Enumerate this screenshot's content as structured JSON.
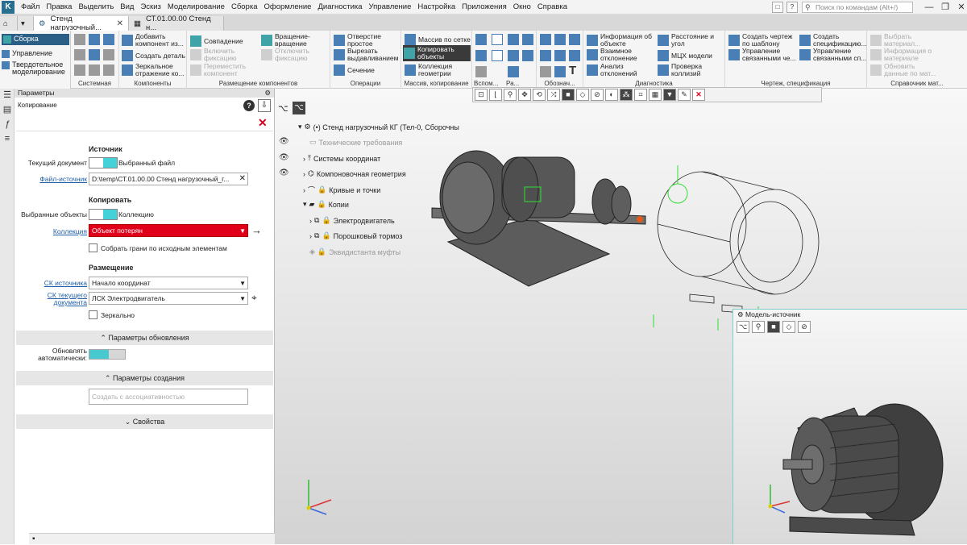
{
  "menubar": {
    "items": [
      "Файл",
      "Правка",
      "Выделить",
      "Вид",
      "Эскиз",
      "Моделирование",
      "Сборка",
      "Оформление",
      "Диагностика",
      "Управление",
      "Настройка",
      "Приложения",
      "Окно",
      "Справка"
    ],
    "search_placeholder": "Поиск по командам (Alt+/)"
  },
  "tabs": {
    "active": "Стенд нагрузочный...",
    "inactive": "СТ.01.00.00  Стенд н..."
  },
  "ribbon": {
    "left": {
      "assembly": "Сборка",
      "control": "Управление",
      "solid": "Твердотельное моделирование"
    },
    "systemnaya": "Системная",
    "components": {
      "label": "Компоненты",
      "add": "Добавить компонент из...",
      "create": "Создать деталь",
      "mirror": "Зеркальное отражение ко..."
    },
    "placement": {
      "label": "Размещение компонентов",
      "coincide": "Совпадение",
      "rotation": "Вращение-вращение",
      "enable_fix": "Включить фиксацию",
      "disable_fix": "Отключить фиксацию",
      "move": "Переместить компонент"
    },
    "operations": {
      "label": "Операции",
      "hole": "Отверстие простое",
      "cut": "Вырезать выдавливанием",
      "section": "Сечение"
    },
    "array": {
      "label": "Массив, копирование",
      "grid": "Массив по сетке",
      "copy": "Копировать объекты",
      "collection": "Коллекция геометрии"
    },
    "aux": "Вспом...",
    "ra": "Ра...",
    "notes": "Обознач...",
    "diagnostics": {
      "label": "Диагностика",
      "info": "Информация об объекте",
      "deviation": "Взаимное отклонение",
      "analysis": "Анализ отклонений",
      "distance": "Расстояние и угол",
      "mcx": "МЦХ модели",
      "collision": "Проверка коллизий"
    },
    "drawing": {
      "label": "Чертеж, спецификация",
      "create_drawing": "Создать чертеж по шаблону",
      "manage_docs": "Управление связанными че...",
      "create_spec": "Создать спецификацию...",
      "manage_spec": "Управление связанными сп..."
    },
    "reference": {
      "label": "Справочник мат...",
      "choose": "Выбрать материал...",
      "material": "Информация о материале",
      "update": "Обновить данные по мат..."
    }
  },
  "params": {
    "header": "Параметры",
    "subtitle": "Копирование",
    "source_title": "Источник",
    "current_doc_label": "Текущий документ",
    "selected_file_label": "Выбранный файл",
    "file_source_link": "Файл-источник",
    "file_source_value": "D:\\temp\\СТ.01.00.00 Стенд нагрузочный_г...",
    "copy_title": "Копировать",
    "selected_objects_label": "Выбранные объекты",
    "collection_opt": "Коллекцию",
    "collection_link": "Коллекция",
    "collection_value": "Объект потерян",
    "collect_faces": "Собрать грани по исходным элементам",
    "placement_title": "Размещение",
    "cs_source_link": "СК источника",
    "cs_source_value": "Начало координат",
    "cs_current_link": "СК текущего документа",
    "cs_current_value": "ЛСК Электродвигатель",
    "mirror": "Зеркально",
    "update_section": "Параметры обновления",
    "auto_update": "Обновлять автоматически:",
    "create_section": "Параметры создания",
    "create_with_assoc": "Создать с ассоциативностью",
    "properties_section": "Свойства"
  },
  "tree": {
    "root": "(•) Стенд нагрузочный КГ (Тел-0, Сборочны",
    "items": [
      "Технические требования",
      "Системы координат",
      "Компоновочная геометрия",
      "Кривые и точки",
      "Копии",
      "Электродвигатель",
      "Порошковый тормоз",
      "Эквидистанта муфты"
    ]
  },
  "preview": {
    "title": "Модель-источник"
  },
  "colors": {
    "accent": "#44d2d8",
    "error": "#e0001a",
    "brand": "#2c5f86"
  }
}
